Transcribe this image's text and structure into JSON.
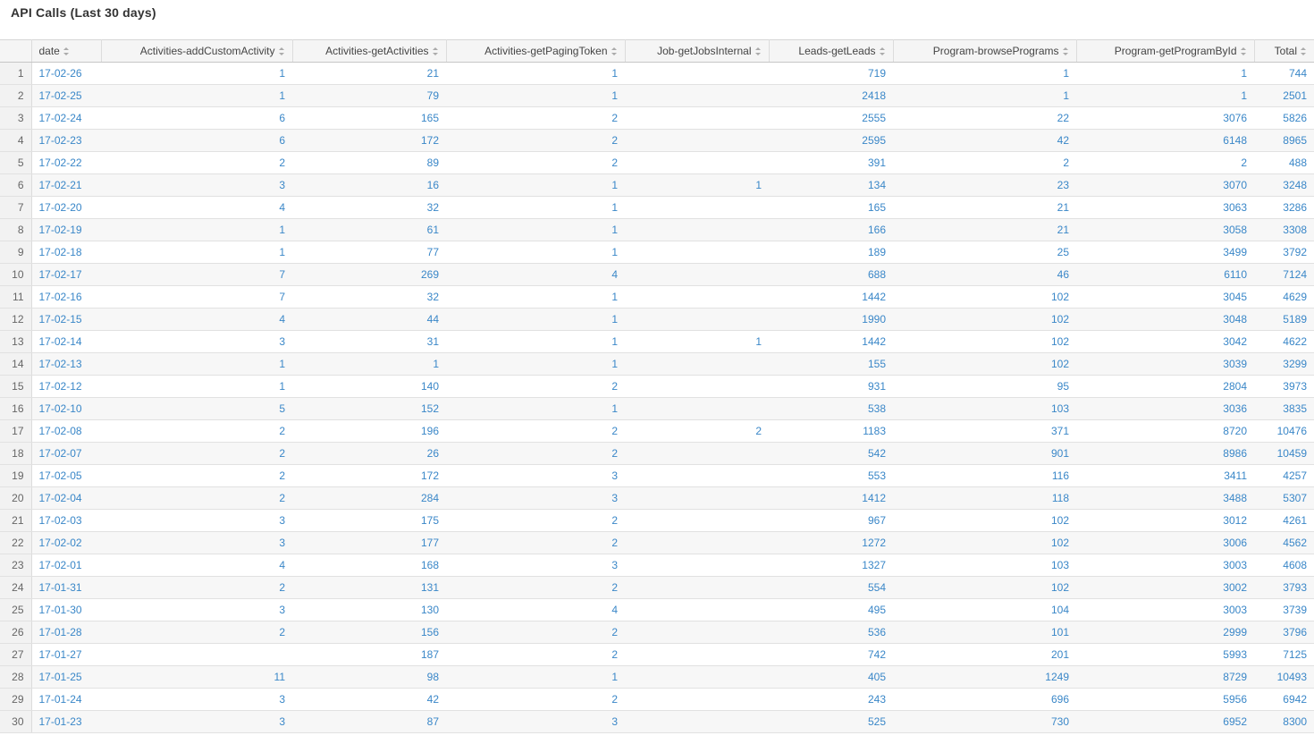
{
  "panel": {
    "title": "API Calls (Last 30 days)"
  },
  "table": {
    "columns": [
      "date",
      "Activities-addCustomActivity",
      "Activities-getActivities",
      "Activities-getPagingToken",
      "Job-getJobsInternal",
      "Leads-getLeads",
      "Program-browsePrograms",
      "Program-getProgramById",
      "Total"
    ],
    "rows": [
      [
        "1",
        "17-02-26",
        "1",
        "21",
        "1",
        "",
        "719",
        "1",
        "1",
        "744"
      ],
      [
        "2",
        "17-02-25",
        "1",
        "79",
        "1",
        "",
        "2418",
        "1",
        "1",
        "2501"
      ],
      [
        "3",
        "17-02-24",
        "6",
        "165",
        "2",
        "",
        "2555",
        "22",
        "3076",
        "5826"
      ],
      [
        "4",
        "17-02-23",
        "6",
        "172",
        "2",
        "",
        "2595",
        "42",
        "6148",
        "8965"
      ],
      [
        "5",
        "17-02-22",
        "2",
        "89",
        "2",
        "",
        "391",
        "2",
        "2",
        "488"
      ],
      [
        "6",
        "17-02-21",
        "3",
        "16",
        "1",
        "1",
        "134",
        "23",
        "3070",
        "3248"
      ],
      [
        "7",
        "17-02-20",
        "4",
        "32",
        "1",
        "",
        "165",
        "21",
        "3063",
        "3286"
      ],
      [
        "8",
        "17-02-19",
        "1",
        "61",
        "1",
        "",
        "166",
        "21",
        "3058",
        "3308"
      ],
      [
        "9",
        "17-02-18",
        "1",
        "77",
        "1",
        "",
        "189",
        "25",
        "3499",
        "3792"
      ],
      [
        "10",
        "17-02-17",
        "7",
        "269",
        "4",
        "",
        "688",
        "46",
        "6110",
        "7124"
      ],
      [
        "11",
        "17-02-16",
        "7",
        "32",
        "1",
        "",
        "1442",
        "102",
        "3045",
        "4629"
      ],
      [
        "12",
        "17-02-15",
        "4",
        "44",
        "1",
        "",
        "1990",
        "102",
        "3048",
        "5189"
      ],
      [
        "13",
        "17-02-14",
        "3",
        "31",
        "1",
        "1",
        "1442",
        "102",
        "3042",
        "4622"
      ],
      [
        "14",
        "17-02-13",
        "1",
        "1",
        "1",
        "",
        "155",
        "102",
        "3039",
        "3299"
      ],
      [
        "15",
        "17-02-12",
        "1",
        "140",
        "2",
        "",
        "931",
        "95",
        "2804",
        "3973"
      ],
      [
        "16",
        "17-02-10",
        "5",
        "152",
        "1",
        "",
        "538",
        "103",
        "3036",
        "3835"
      ],
      [
        "17",
        "17-02-08",
        "2",
        "196",
        "2",
        "2",
        "1183",
        "371",
        "8720",
        "10476"
      ],
      [
        "18",
        "17-02-07",
        "2",
        "26",
        "2",
        "",
        "542",
        "901",
        "8986",
        "10459"
      ],
      [
        "19",
        "17-02-05",
        "2",
        "172",
        "3",
        "",
        "553",
        "116",
        "3411",
        "4257"
      ],
      [
        "20",
        "17-02-04",
        "2",
        "284",
        "3",
        "",
        "1412",
        "118",
        "3488",
        "5307"
      ],
      [
        "21",
        "17-02-03",
        "3",
        "175",
        "2",
        "",
        "967",
        "102",
        "3012",
        "4261"
      ],
      [
        "22",
        "17-02-02",
        "3",
        "177",
        "2",
        "",
        "1272",
        "102",
        "3006",
        "4562"
      ],
      [
        "23",
        "17-02-01",
        "4",
        "168",
        "3",
        "",
        "1327",
        "103",
        "3003",
        "4608"
      ],
      [
        "24",
        "17-01-31",
        "2",
        "131",
        "2",
        "",
        "554",
        "102",
        "3002",
        "3793"
      ],
      [
        "25",
        "17-01-30",
        "3",
        "130",
        "4",
        "",
        "495",
        "104",
        "3003",
        "3739"
      ],
      [
        "26",
        "17-01-28",
        "2",
        "156",
        "2",
        "",
        "536",
        "101",
        "2999",
        "3796"
      ],
      [
        "27",
        "17-01-27",
        "",
        "187",
        "2",
        "",
        "742",
        "201",
        "5993",
        "7125"
      ],
      [
        "28",
        "17-01-25",
        "11",
        "98",
        "1",
        "",
        "405",
        "1249",
        "8729",
        "10493"
      ],
      [
        "29",
        "17-01-24",
        "3",
        "42",
        "2",
        "",
        "243",
        "696",
        "5956",
        "6942"
      ],
      [
        "30",
        "17-01-23",
        "3",
        "87",
        "3",
        "",
        "525",
        "730",
        "6952",
        "8300"
      ]
    ]
  },
  "colors": {
    "link": "#3a87c8",
    "header_bg": "#f5f5f5",
    "stripe": "#f7f7f7"
  },
  "icons": {
    "sort": "sort-icon"
  }
}
